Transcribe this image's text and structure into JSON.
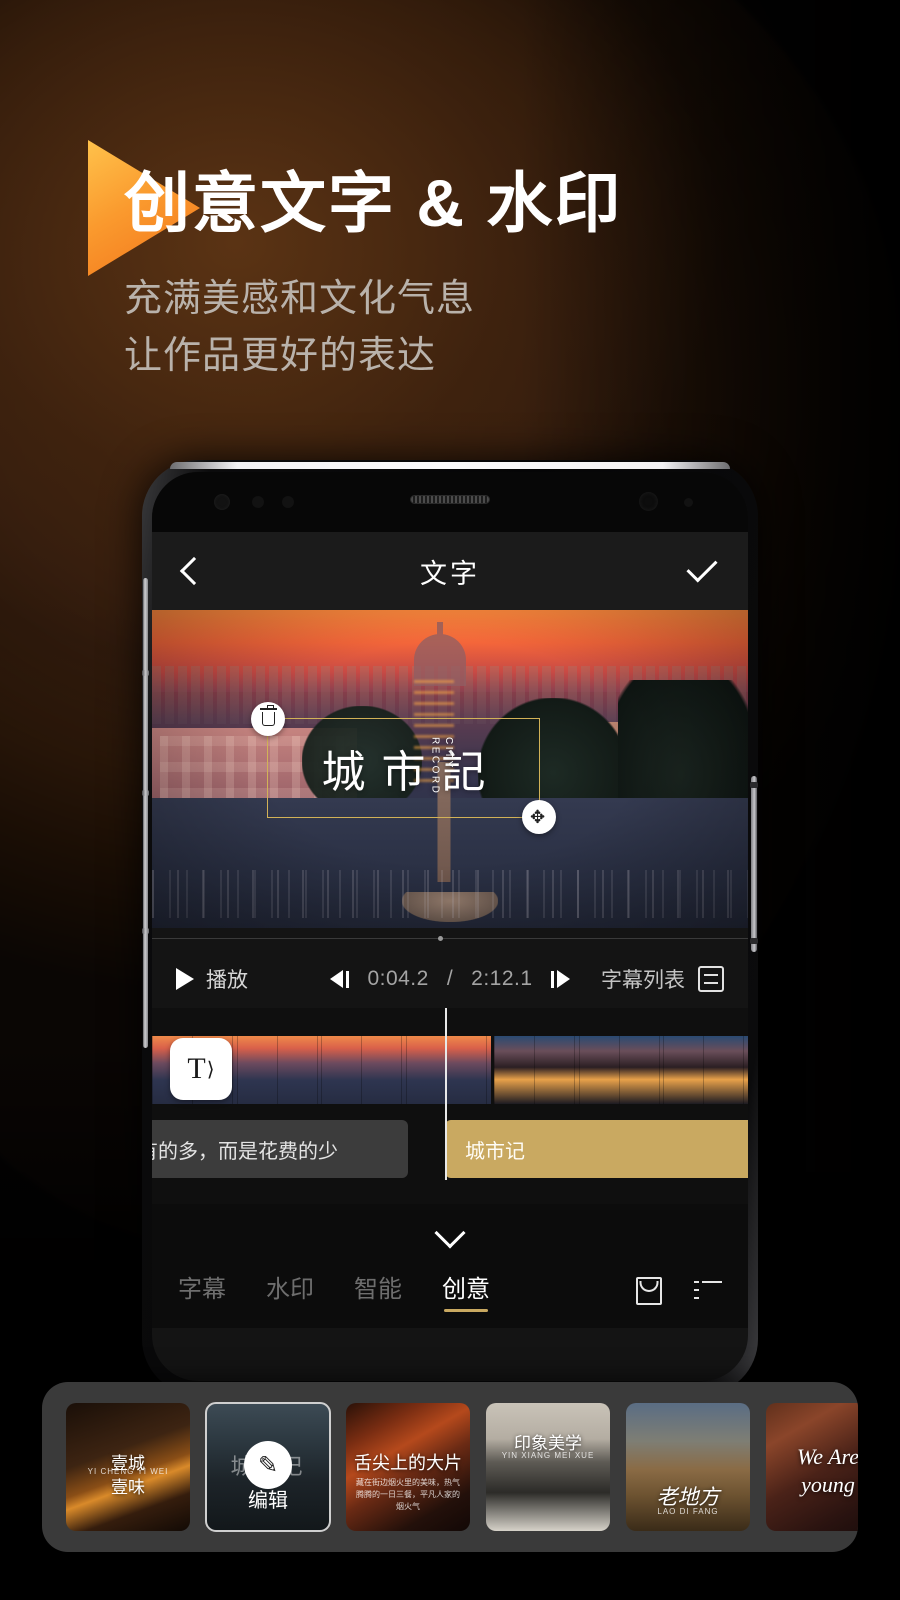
{
  "promo": {
    "headline": "创意文字 & 水印",
    "subline_1": "充满美感和文化气息",
    "subline_2": "让作品更好的表达",
    "accent_orange": "#f2731a",
    "accent_gold": "#c9a961"
  },
  "app": {
    "header": {
      "back_icon": "chevron-left-icon",
      "title": "文字",
      "confirm_icon": "check-icon"
    },
    "preview": {
      "overlay_text": "城市記",
      "overlay_vertical_text": "CITY RECORD",
      "delete_icon": "trash-icon",
      "move_icon": "move-icon"
    },
    "controls": {
      "play_label": "播放",
      "play_icon": "play-icon",
      "step_back_icon": "step-backward-icon",
      "step_forward_icon": "step-forward-icon",
      "current_time": "0:04.2",
      "time_separator": "/",
      "total_time": "2:12.1",
      "subtitle_list_label": "字幕列表",
      "subtitle_list_icon": "list-box-icon"
    },
    "timeline": {
      "audio_badge_icon": "text-to-speech-icon",
      "audio_badge_letter": "T",
      "clip_left_text": "有的多，而是花费的少",
      "clip_right_text": "城市记"
    },
    "tabs": {
      "collapse_icon": "chevron-down-icon",
      "items": [
        {
          "label": "字幕",
          "active": false
        },
        {
          "label": "水印",
          "active": false
        },
        {
          "label": "智能",
          "active": false
        },
        {
          "label": "创意",
          "active": true
        }
      ],
      "store_icon": "shopping-bag-icon",
      "menu_icon": "list-menu-icon"
    }
  },
  "templates": [
    {
      "title_1": "壹城",
      "title_2": "壹味",
      "pinyin": "YI CHENG YI WEI",
      "selected": false
    },
    {
      "ghost": "城市记",
      "edit_label": "编辑",
      "edit_icon": "pencil-icon",
      "selected": true
    },
    {
      "title_1": "舌尖上的大片",
      "body": "藏在街边烟火里的美味，热气腾腾的一日三餐，平凡人家的烟火气",
      "selected": false
    },
    {
      "title_1": "印象美学",
      "pinyin": "YIN XIANG MEI XUE",
      "selected": false
    },
    {
      "title_1": "老地方",
      "pinyin": "LAO DI FANG",
      "selected": false
    },
    {
      "title_1": "We Are young",
      "selected": false
    }
  ]
}
